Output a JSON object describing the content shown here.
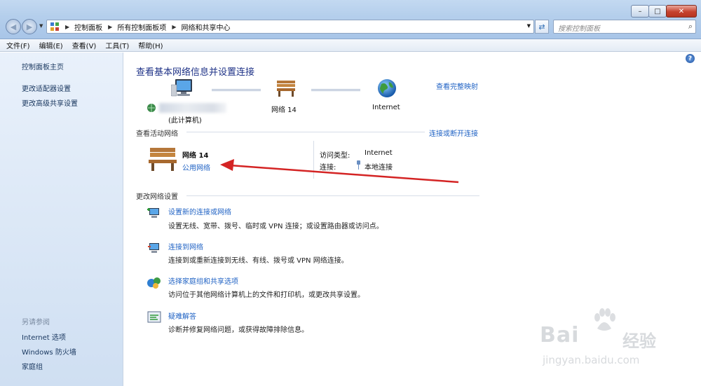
{
  "window": {
    "minimize_glyph": "–",
    "maximize_glyph": "□",
    "close_glyph": "✕"
  },
  "nav": {
    "back_glyph": "◀",
    "forward_glyph": "▶",
    "dropdown_glyph": "▼"
  },
  "address": {
    "breadcrumbs": [
      "控制面板",
      "所有控制面板项",
      "网络和共享中心"
    ],
    "separator": "▶",
    "dropdown_glyph": "▼",
    "refresh_glyph": "⇄"
  },
  "search": {
    "placeholder": "搜索控制面板",
    "icon_glyph": "⌕"
  },
  "menu": [
    "文件(F)",
    "编辑(E)",
    "查看(V)",
    "工具(T)",
    "帮助(H)"
  ],
  "sidebar": {
    "links": [
      "控制面板主页",
      "更改适配器设置",
      "更改高级共享设置"
    ],
    "see_also_heading": "另请参阅",
    "see_also": [
      "Internet 选项",
      "Windows 防火墙",
      "家庭组"
    ]
  },
  "main": {
    "help_glyph": "?",
    "title": "查看基本网络信息并设置连接",
    "view_full_map": "查看完整映射",
    "map": {
      "this_computer": "(此计算机)",
      "network": "网络  14",
      "internet": "Internet"
    },
    "active_networks": {
      "heading": "查看活动网络",
      "action": "连接或断开连接",
      "network_name": "网络  14",
      "network_type": "公用网络",
      "access_type_label": "访问类型:",
      "access_type_value": "Internet",
      "connection_label": "连接:",
      "connection_value": "本地连接"
    },
    "change_settings": {
      "heading": "更改网络设置",
      "tasks": [
        {
          "title": "设置新的连接或网络",
          "desc": "设置无线、宽带、拨号、临时或 VPN 连接；或设置路由器或访问点。"
        },
        {
          "title": "连接到网络",
          "desc": "连接到或重新连接到无线、有线、拨号或 VPN 网络连接。"
        },
        {
          "title": "选择家庭组和共享选项",
          "desc": "访问位于其他网络计算机上的文件和打印机，或更改共享设置。"
        },
        {
          "title": "疑难解答",
          "desc": "诊断并修复网络问题，或获得故障排除信息。"
        }
      ]
    }
  },
  "watermark": {
    "brand": "Bai",
    "brand_tail": "经验",
    "url": "jingyan.baidu.com"
  },
  "colors": {
    "link": "#1f62c4",
    "title": "#1e3287",
    "annotation_arrow": "#d42424"
  }
}
